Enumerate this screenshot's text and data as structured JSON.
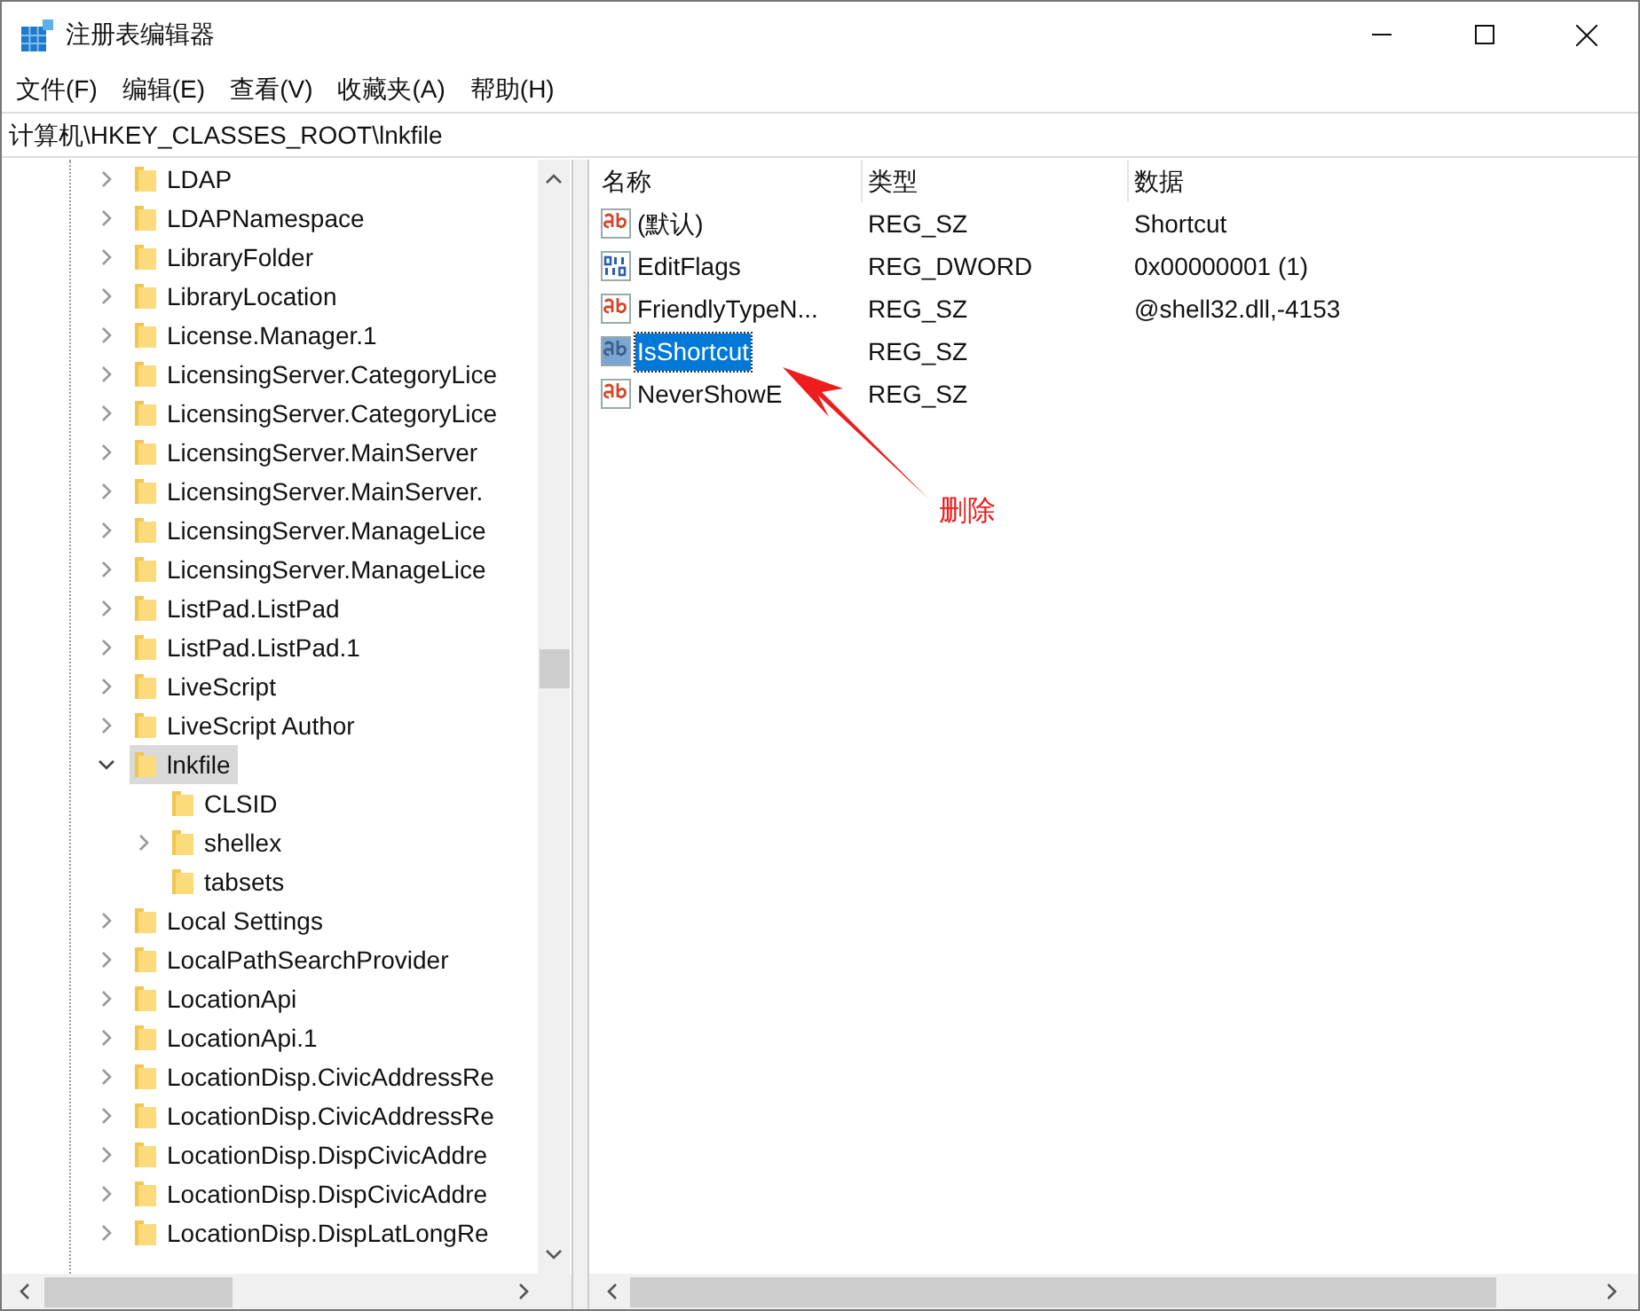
{
  "window": {
    "title": "注册表编辑器"
  },
  "menu": [
    "文件(F)",
    "编辑(E)",
    "查看(V)",
    "收藏夹(A)",
    "帮助(H)"
  ],
  "address": "计算机\\HKEY_CLASSES_ROOT\\lnkfile",
  "tree": [
    {
      "label": "LDAP",
      "expandable": true,
      "expanded": false,
      "selected": false
    },
    {
      "label": "LDAPNamespace",
      "expandable": true,
      "expanded": false,
      "selected": false
    },
    {
      "label": "LibraryFolder",
      "expandable": true,
      "expanded": false,
      "selected": false
    },
    {
      "label": "LibraryLocation",
      "expandable": true,
      "expanded": false,
      "selected": false
    },
    {
      "label": "License.Manager.1",
      "expandable": true,
      "expanded": false,
      "selected": false
    },
    {
      "label": "LicensingServer.CategoryLice",
      "expandable": true,
      "expanded": false,
      "selected": false
    },
    {
      "label": "LicensingServer.CategoryLice",
      "expandable": true,
      "expanded": false,
      "selected": false
    },
    {
      "label": "LicensingServer.MainServer",
      "expandable": true,
      "expanded": false,
      "selected": false
    },
    {
      "label": "LicensingServer.MainServer.",
      "expandable": true,
      "expanded": false,
      "selected": false
    },
    {
      "label": "LicensingServer.ManageLice",
      "expandable": true,
      "expanded": false,
      "selected": false
    },
    {
      "label": "LicensingServer.ManageLice",
      "expandable": true,
      "expanded": false,
      "selected": false
    },
    {
      "label": "ListPad.ListPad",
      "expandable": true,
      "expanded": false,
      "selected": false
    },
    {
      "label": "ListPad.ListPad.1",
      "expandable": true,
      "expanded": false,
      "selected": false
    },
    {
      "label": "LiveScript",
      "expandable": true,
      "expanded": false,
      "selected": false
    },
    {
      "label": "LiveScript Author",
      "expandable": true,
      "expanded": false,
      "selected": false
    },
    {
      "label": "lnkfile",
      "expandable": true,
      "expanded": true,
      "selected": true,
      "children": [
        {
          "label": "CLSID",
          "expandable": false,
          "selected": false
        },
        {
          "label": "shellex",
          "expandable": true,
          "expanded": false,
          "selected": false
        },
        {
          "label": "tabsets",
          "expandable": false,
          "selected": false
        }
      ]
    },
    {
      "label": "Local Settings",
      "expandable": true,
      "expanded": false,
      "selected": false
    },
    {
      "label": "LocalPathSearchProvider",
      "expandable": true,
      "expanded": false,
      "selected": false
    },
    {
      "label": "LocationApi",
      "expandable": true,
      "expanded": false,
      "selected": false
    },
    {
      "label": "LocationApi.1",
      "expandable": true,
      "expanded": false,
      "selected": false
    },
    {
      "label": "LocationDisp.CivicAddressRe",
      "expandable": true,
      "expanded": false,
      "selected": false
    },
    {
      "label": "LocationDisp.CivicAddressRe",
      "expandable": true,
      "expanded": false,
      "selected": false
    },
    {
      "label": "LocationDisp.DispCivicAddre",
      "expandable": true,
      "expanded": false,
      "selected": false
    },
    {
      "label": "LocationDisp.DispCivicAddre",
      "expandable": true,
      "expanded": false,
      "selected": false
    },
    {
      "label": "LocationDisp.DispLatLongRe",
      "expandable": true,
      "expanded": false,
      "selected": false
    }
  ],
  "table": {
    "columns": [
      "名称",
      "类型",
      "数据"
    ],
    "rows": [
      {
        "kind": "string",
        "name": "(默认)",
        "type": "REG_SZ",
        "data": "Shortcut",
        "selected": false
      },
      {
        "kind": "binary",
        "name": "EditFlags",
        "type": "REG_DWORD",
        "data": "0x00000001 (1)",
        "selected": false
      },
      {
        "kind": "string",
        "name": "FriendlyTypeN...",
        "type": "REG_SZ",
        "data": "@shell32.dll,-4153",
        "selected": false
      },
      {
        "kind": "string",
        "name": "IsShortcut",
        "type": "REG_SZ",
        "selected": true
      },
      {
        "kind": "string",
        "name": "NeverShowE",
        "type": "REG_SZ",
        "selected": false
      }
    ]
  },
  "annotation": {
    "label": "删除"
  }
}
